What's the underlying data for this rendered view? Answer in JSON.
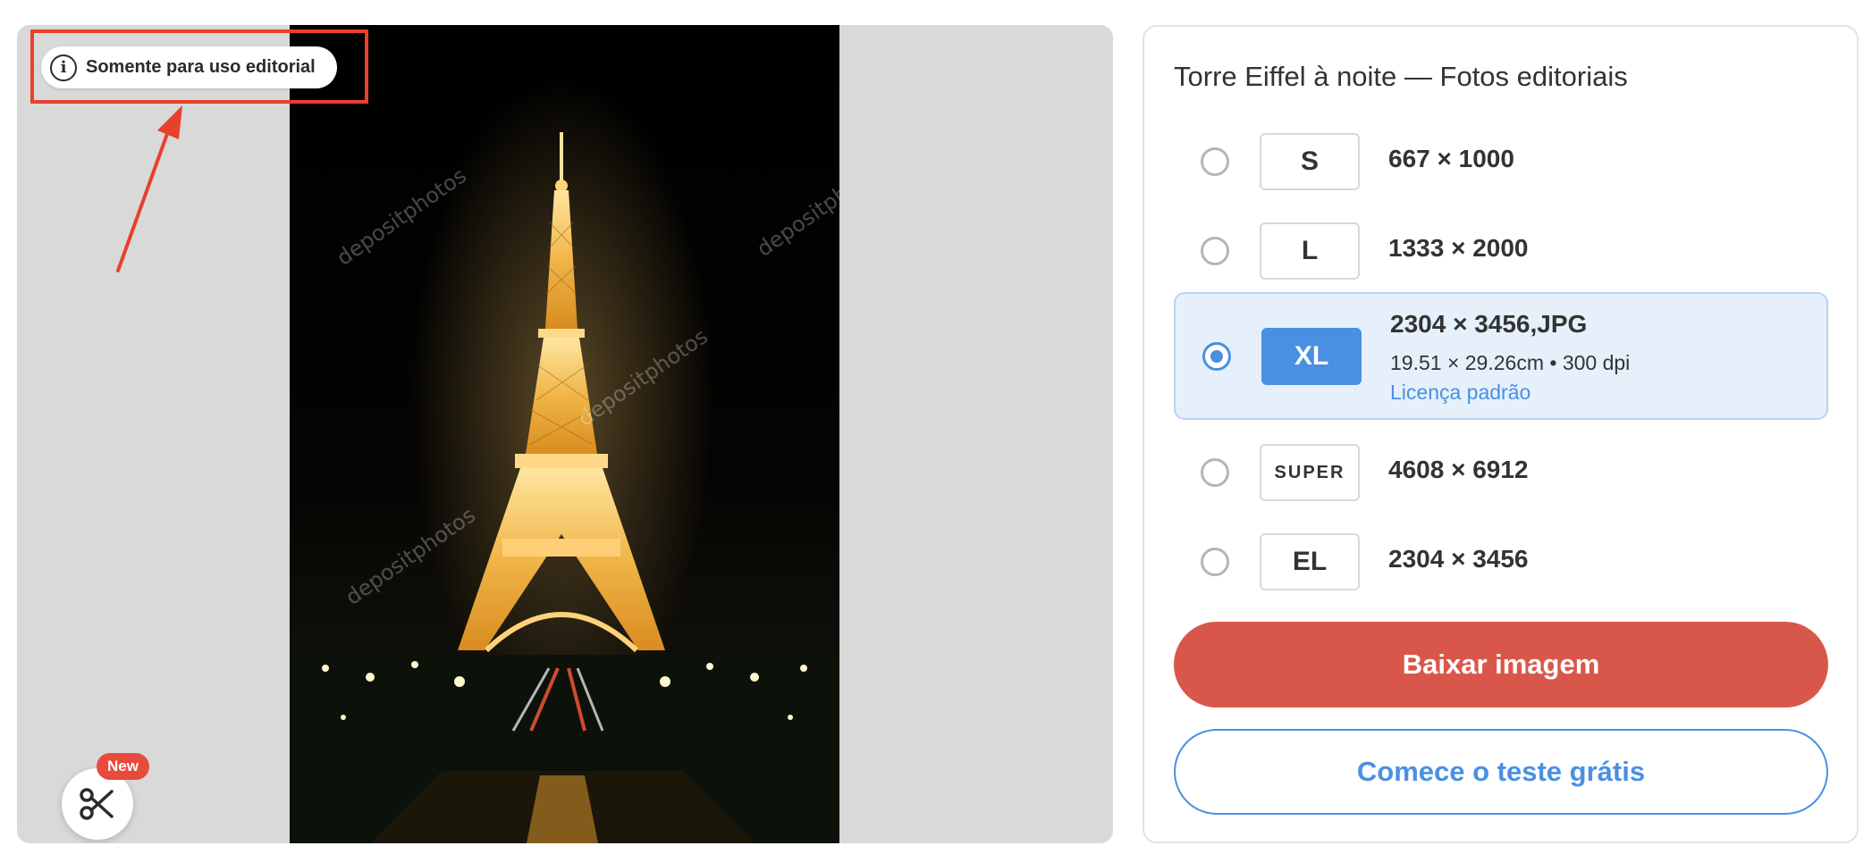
{
  "preview": {
    "badge_text": "Somente para uso editorial",
    "new_label": "New"
  },
  "panel": {
    "title": "Torre Eiffel à noite — Fotos editoriais",
    "options": [
      {
        "size": "S",
        "dims": "667 × 1000",
        "selected": false
      },
      {
        "size": "L",
        "dims": "1333 × 2000",
        "selected": false
      },
      {
        "size": "XL",
        "dims": "2304 × 3456,JPG",
        "sub": "19.51 × 29.26cm • 300 dpi",
        "license": "Licença padrão",
        "selected": true
      },
      {
        "size": "SUPER",
        "dims": "4608 × 6912",
        "selected": false
      },
      {
        "size": "EL",
        "dims": "2304 × 3456",
        "selected": false
      }
    ],
    "download_label": "Baixar imagem",
    "trial_label": "Comece o teste grátis"
  },
  "colors": {
    "accent_blue": "#4a90e2",
    "download_red": "#d9574a",
    "annotation_red": "#e8402c"
  },
  "icons": [
    "info-icon",
    "scissors-icon",
    "radio-icon",
    "annotation-arrow"
  ]
}
